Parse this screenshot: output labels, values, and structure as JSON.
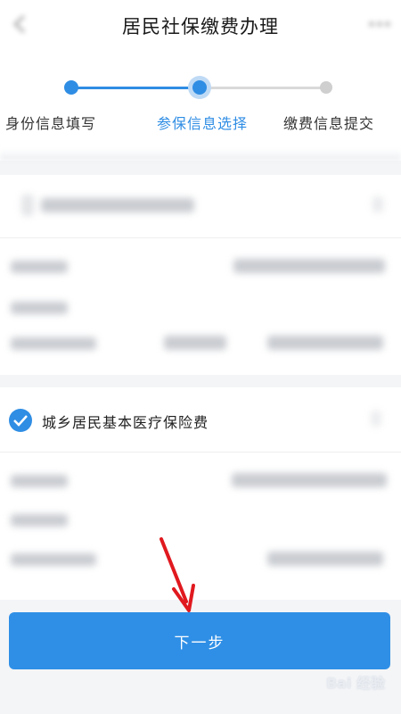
{
  "header": {
    "title": "居民社保缴费办理"
  },
  "stepper": {
    "steps": [
      {
        "label": "身份信息填写",
        "state": "done"
      },
      {
        "label": "参保信息选择",
        "state": "current"
      },
      {
        "label": "缴费信息提交",
        "state": "todo"
      }
    ]
  },
  "insurance_option": {
    "label": "城乡居民基本医疗保险费",
    "checked": true
  },
  "footer": {
    "next_label": "下一步"
  },
  "watermark": {
    "text": "Bai 经验"
  },
  "colors": {
    "accent": "#2f8de4",
    "button": "#2f8fe6",
    "annotation": "#e0191f"
  },
  "icons": [
    "back-icon",
    "more-icon",
    "check-icon",
    "red-arrow-annotation"
  ]
}
